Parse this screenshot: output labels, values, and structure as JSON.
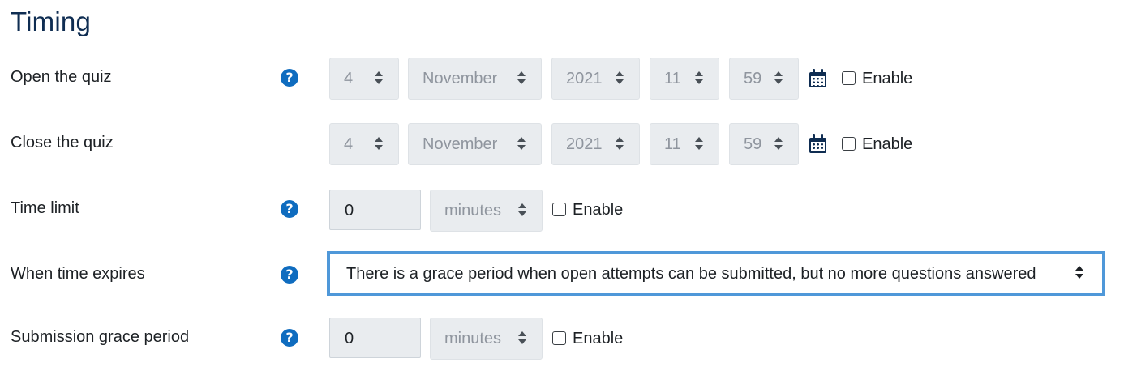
{
  "section_title": "Timing",
  "open_quiz": {
    "label": "Open the quiz",
    "day": "4",
    "month": "November",
    "year": "2021",
    "hour": "11",
    "minute": "59",
    "enable_label": "Enable"
  },
  "close_quiz": {
    "label": "Close the quiz",
    "day": "4",
    "month": "November",
    "year": "2021",
    "hour": "11",
    "minute": "59",
    "enable_label": "Enable"
  },
  "time_limit": {
    "label": "Time limit",
    "value": "0",
    "unit": "minutes",
    "enable_label": "Enable"
  },
  "when_time_expires": {
    "label": "When time expires",
    "value": "There is a grace period when open attempts can be submitted, but no more questions answered"
  },
  "grace_period": {
    "label": "Submission grace period",
    "value": "0",
    "unit": "minutes",
    "enable_label": "Enable"
  },
  "help_icon_glyph": "?",
  "colors": {
    "title": "#0f2d52",
    "help_icon": "#0f6cbf",
    "focus_border": "#4f98d9",
    "disabled_bg": "#e9ecef"
  }
}
